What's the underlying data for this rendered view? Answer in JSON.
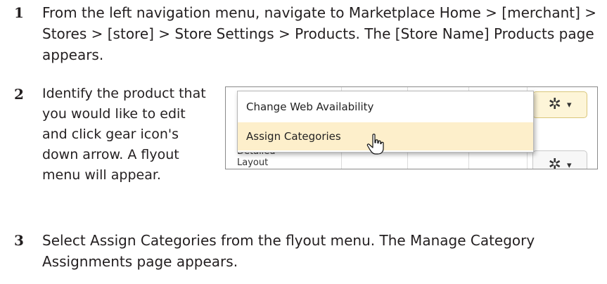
{
  "steps": [
    {
      "number": "1",
      "text": "From the left navigation menu, navigate to Marketplace Home > [merchant] > Stores > [store] > Store Settings > Products. The [Store Name] Products page appears."
    },
    {
      "number": "2",
      "text": "Identify the product that you would like to edit and click gear icon's down arrow. A flyout menu will appear."
    },
    {
      "number": "3",
      "text": "Select Assign Categories from the flyout menu. The Manage Category Assignments page appears."
    }
  ],
  "figure": {
    "menu_items": [
      "Change Web Availability",
      "Assign Categories"
    ],
    "partial_cell_lines": [
      "Detailed",
      "Layout"
    ],
    "icons": {
      "gear": "gear-icon",
      "caret": "caret-down-icon",
      "cursor": "hand-pointer-icon"
    },
    "colors": {
      "highlight": "#fdefcb",
      "gear_button": "#fdf5d8",
      "tick_green": "#5cb85c",
      "tick_red": "#d9534f"
    }
  }
}
